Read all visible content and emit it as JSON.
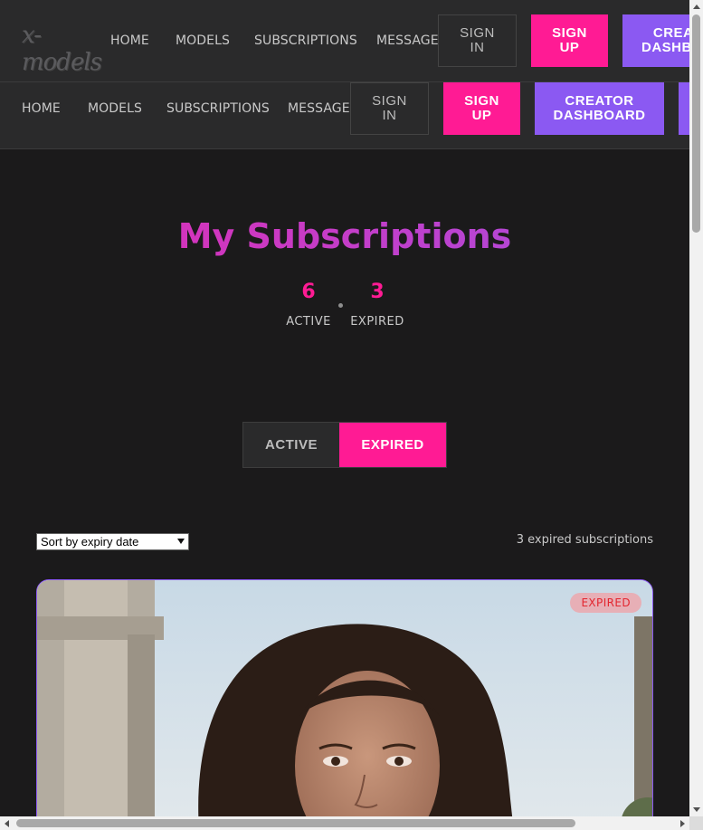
{
  "logo": {
    "text": "x-models"
  },
  "header": {
    "nav": [
      "HOME",
      "MODELS",
      "SUBSCRIPTIONS",
      "MESSAGES"
    ],
    "signin_label": "SIGN\nIN",
    "signup_label": "SIGN\nUP",
    "creator_label": "CREATOR\nDASHBOARD"
  },
  "page": {
    "title": "My Subscriptions",
    "stats": {
      "active_count": "6",
      "active_label": "ACTIVE",
      "expired_count": "3",
      "expired_label": "EXPIRED"
    }
  },
  "tabs": {
    "active_label": "ACTIVE",
    "expired_label": "EXPIRED",
    "selected": "EXPIRED"
  },
  "filters": {
    "sort_selected": "Sort by expiry date",
    "result_count": "3 expired subscriptions"
  },
  "cards": [
    {
      "status_badge": "EXPIRED"
    }
  ],
  "colors": {
    "accent_pink": "#ff1b94",
    "accent_purple": "#8b59f2",
    "background": "#1b1a1b",
    "header_bg": "#2a2a2b",
    "expired_text": "#e3262f"
  }
}
